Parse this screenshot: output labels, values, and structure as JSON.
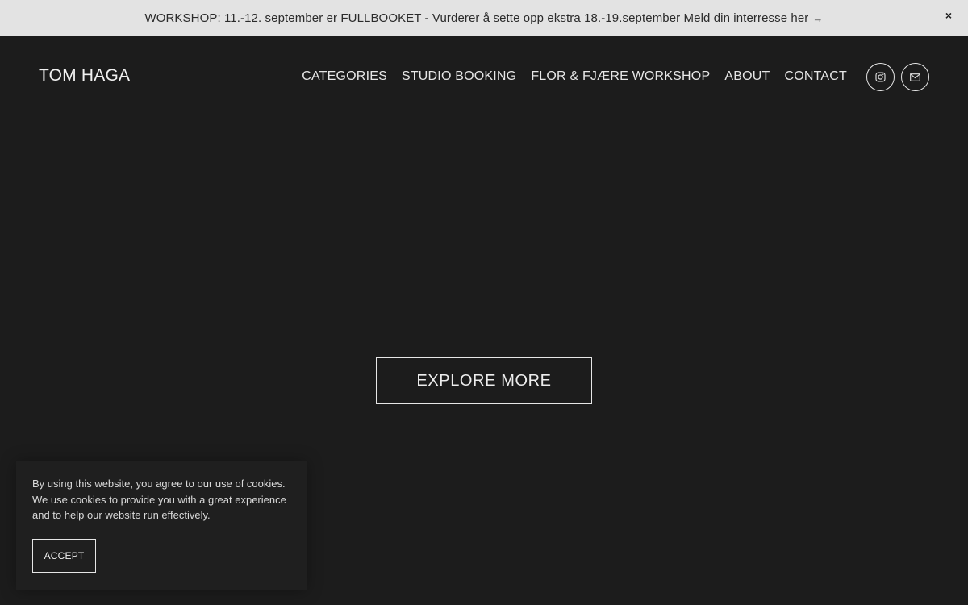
{
  "announcement": {
    "text": "WORKSHOP: 11.-12. september er FULLBOOKET - Vurderer å sette opp ekstra 18.-19.september  Meld din interresse her",
    "arrow": "→",
    "close": "×"
  },
  "header": {
    "logo": "TOM HAGA",
    "nav": [
      "CATEGORIES",
      "STUDIO BOOKING",
      "FLOR & FJÆRE WORKSHOP",
      "ABOUT",
      "CONTACT"
    ],
    "social_icons": [
      "instagram-icon",
      "mail-icon"
    ]
  },
  "hero": {
    "button": "EXPLORE MORE"
  },
  "cookie_banner": {
    "text": "By using this website, you agree to our use of cookies. We use cookies to provide you with a great experience and to help our website run effectively.",
    "accept": "ACCEPT"
  },
  "colors": {
    "background": "#1c1c1c",
    "announcement_bg": "#e3e3e3",
    "text_light": "#e6e6e6",
    "text_dark": "#2b2b2b"
  }
}
